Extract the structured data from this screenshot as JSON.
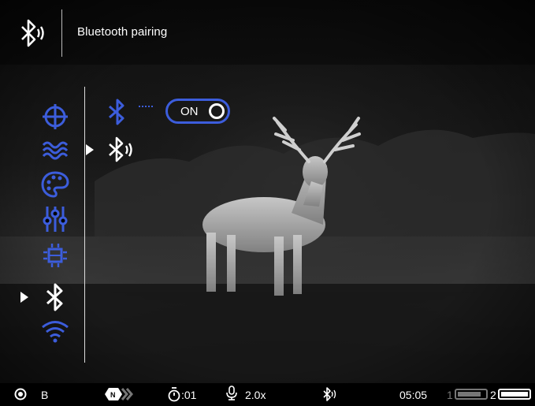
{
  "header": {
    "title": "Bluetooth pairing",
    "icon": "bluetooth-sound-icon"
  },
  "menu": {
    "items": [
      {
        "name": "reticle-icon"
      },
      {
        "name": "waves-icon"
      },
      {
        "name": "palette-icon"
      },
      {
        "name": "sliders-icon"
      },
      {
        "name": "chip-icon"
      },
      {
        "name": "bluetooth-icon",
        "selected": true
      },
      {
        "name": "wifi-icon"
      }
    ]
  },
  "submenu": {
    "bluetooth_toggle": {
      "label": "ON",
      "state": "on"
    },
    "pairing": {
      "icon": "bluetooth-sound-icon",
      "selected": true
    }
  },
  "status": {
    "mode": "B",
    "timer": ":01",
    "zoom": "2.0x",
    "time": "05:05",
    "battery1_label": "1",
    "battery2_label": "2",
    "battery1_level": 0.85,
    "battery2_level": 1.0
  },
  "colors": {
    "accent": "#3c5ddc",
    "text": "#ffffff",
    "background": "#000000"
  }
}
